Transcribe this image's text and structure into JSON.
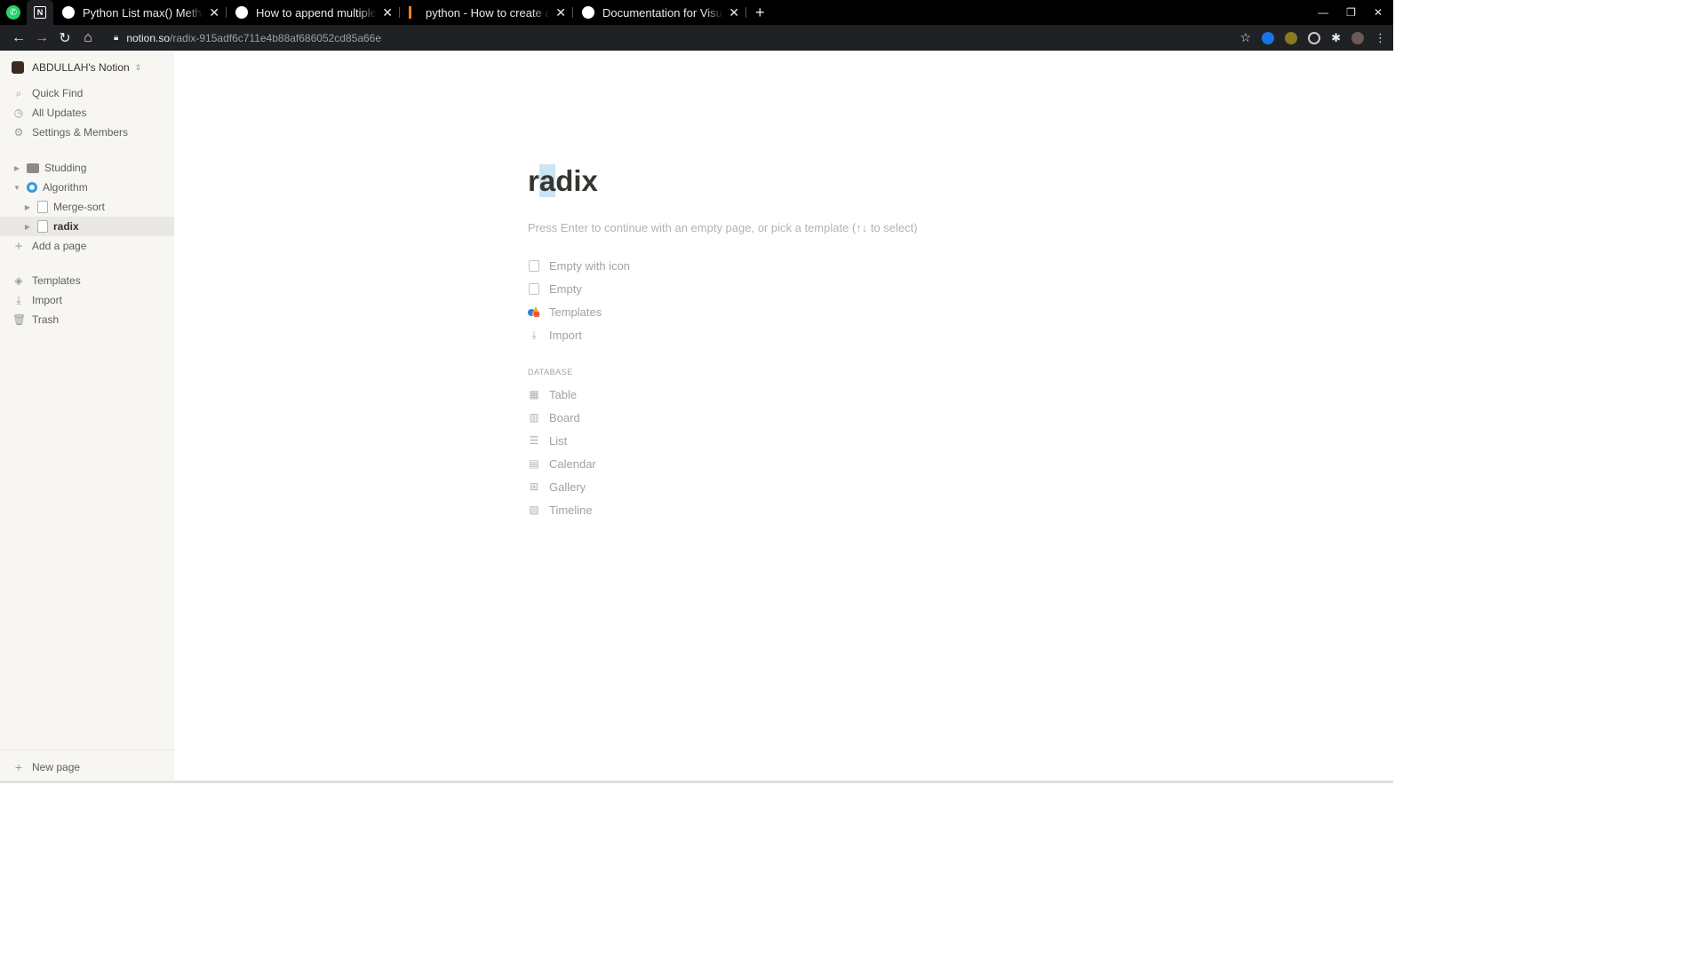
{
  "browser": {
    "tabs": [
      {
        "title": "Python List max() Method"
      },
      {
        "title": "How to append multiple a"
      },
      {
        "title": "python - How to create a li"
      },
      {
        "title": "Documentation for Visual"
      }
    ],
    "url_host": "notion.so",
    "url_path": "/radix-915adf6c711e4b88af686052cd85a66e"
  },
  "sidebar": {
    "workspace": "ABDULLAH's Notion",
    "top_items": [
      "Quick Find",
      "All Updates",
      "Settings & Members"
    ],
    "tree": [
      {
        "label": "Studding"
      },
      {
        "label": "Algorithm"
      },
      {
        "label": "Merge-sort"
      },
      {
        "label": "radix"
      }
    ],
    "add_page": "Add a page",
    "bottom_items": [
      "Templates",
      "Import",
      "Trash"
    ],
    "new_page": "New page"
  },
  "page": {
    "title_pre": "r",
    "title_sel": "a",
    "title_post": "dix",
    "hint": "Press Enter to continue with an empty page, or pick a template (↑↓ to select)",
    "options": [
      "Empty with icon",
      "Empty",
      "Templates",
      "Import"
    ],
    "database_label": "DATABASE",
    "database_options": [
      "Table",
      "Board",
      "List",
      "Calendar",
      "Gallery",
      "Timeline"
    ]
  }
}
